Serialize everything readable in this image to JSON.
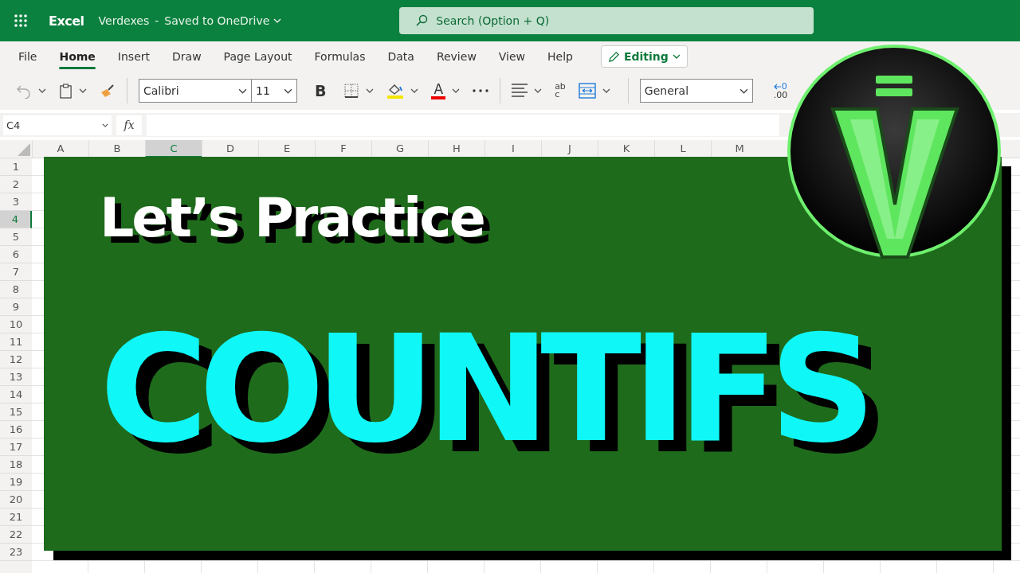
{
  "app_bar": {
    "app_name": "Excel",
    "document": "Verdexes",
    "separator": "-",
    "save_status": "Saved to OneDrive",
    "search": {
      "placeholder": "Search (Option + Q)"
    }
  },
  "ribbon_tabs": [
    {
      "label": "File",
      "selected": false
    },
    {
      "label": "Home",
      "selected": true
    },
    {
      "label": "Insert",
      "selected": false
    },
    {
      "label": "Draw",
      "selected": false
    },
    {
      "label": "Page Layout",
      "selected": false
    },
    {
      "label": "Formulas",
      "selected": false
    },
    {
      "label": "Data",
      "selected": false
    },
    {
      "label": "Review",
      "selected": false
    },
    {
      "label": "View",
      "selected": false
    },
    {
      "label": "Help",
      "selected": false
    }
  ],
  "mode_button": "Editing",
  "toolbar": {
    "font": "Calibri",
    "font_size": "11",
    "bold": "B",
    "font_color_letter": "A",
    "wrap_text": {
      "line1": "ab",
      "line2": "c"
    },
    "number_format": "General",
    "decrease_decimal": {
      "line1": "0",
      "line2": ".00"
    }
  },
  "formula_bar": {
    "name_box": "C4",
    "function_label": "fx"
  },
  "columns": [
    {
      "label": "A",
      "selected": false
    },
    {
      "label": "B",
      "selected": false
    },
    {
      "label": "C",
      "selected": true
    },
    {
      "label": "D",
      "selected": false
    },
    {
      "label": "E",
      "selected": false
    },
    {
      "label": "F",
      "selected": false
    },
    {
      "label": "G",
      "selected": false
    },
    {
      "label": "H",
      "selected": false
    },
    {
      "label": "I",
      "selected": false
    },
    {
      "label": "J",
      "selected": false
    },
    {
      "label": "K",
      "selected": false
    },
    {
      "label": "L",
      "selected": false
    },
    {
      "label": "M",
      "selected": false
    }
  ],
  "rows": [
    {
      "label": "1",
      "selected": false
    },
    {
      "label": "2",
      "selected": false
    },
    {
      "label": "3",
      "selected": false
    },
    {
      "label": "4",
      "selected": true
    },
    {
      "label": "5",
      "selected": false
    },
    {
      "label": "6",
      "selected": false
    },
    {
      "label": "7",
      "selected": false
    },
    {
      "label": "8",
      "selected": false
    },
    {
      "label": "9",
      "selected": false
    },
    {
      "label": "10",
      "selected": false
    },
    {
      "label": "11",
      "selected": false
    },
    {
      "label": "12",
      "selected": false
    },
    {
      "label": "13",
      "selected": false
    },
    {
      "label": "14",
      "selected": false
    },
    {
      "label": "15",
      "selected": false
    },
    {
      "label": "16",
      "selected": false
    },
    {
      "label": "17",
      "selected": false
    },
    {
      "label": "18",
      "selected": false
    },
    {
      "label": "19",
      "selected": false
    },
    {
      "label": "20",
      "selected": false
    },
    {
      "label": "21",
      "selected": false
    },
    {
      "label": "22",
      "selected": false
    },
    {
      "label": "23",
      "selected": false
    }
  ],
  "banner": {
    "subtitle": "Let’s Practice",
    "title": "COUNTIFS"
  }
}
